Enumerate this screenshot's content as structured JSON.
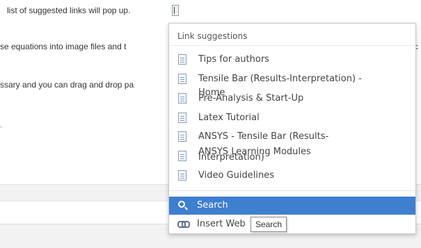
{
  "editor": {
    "line1": "list of suggested links will pop up.",
    "line2": "se equations into image files and t",
    "line2_tail": "nc",
    "line3": "ssary and you can drag and drop pa",
    "line4": ","
  },
  "popup": {
    "header": "Link suggestions",
    "items": [
      {
        "label": "Tips for authors"
      },
      {
        "label": "Tensile Bar (Results-Interpretation) -"
      },
      {
        "label": "Home"
      },
      {
        "label": "Pre-Analysis & Start-Up"
      },
      {
        "label": "Latex Tutorial"
      },
      {
        "label": "ANSYS - Tensile Bar (Results-"
      },
      {
        "label": "Interpretation)"
      },
      {
        "label": "ANSYS Learning Modules"
      },
      {
        "label": "Video Guidelines"
      }
    ],
    "search_label": "Search",
    "insert_label": "Insert Web"
  },
  "tooltip": {
    "text": "Search"
  },
  "colors": {
    "highlight": "#3f7fcf"
  }
}
